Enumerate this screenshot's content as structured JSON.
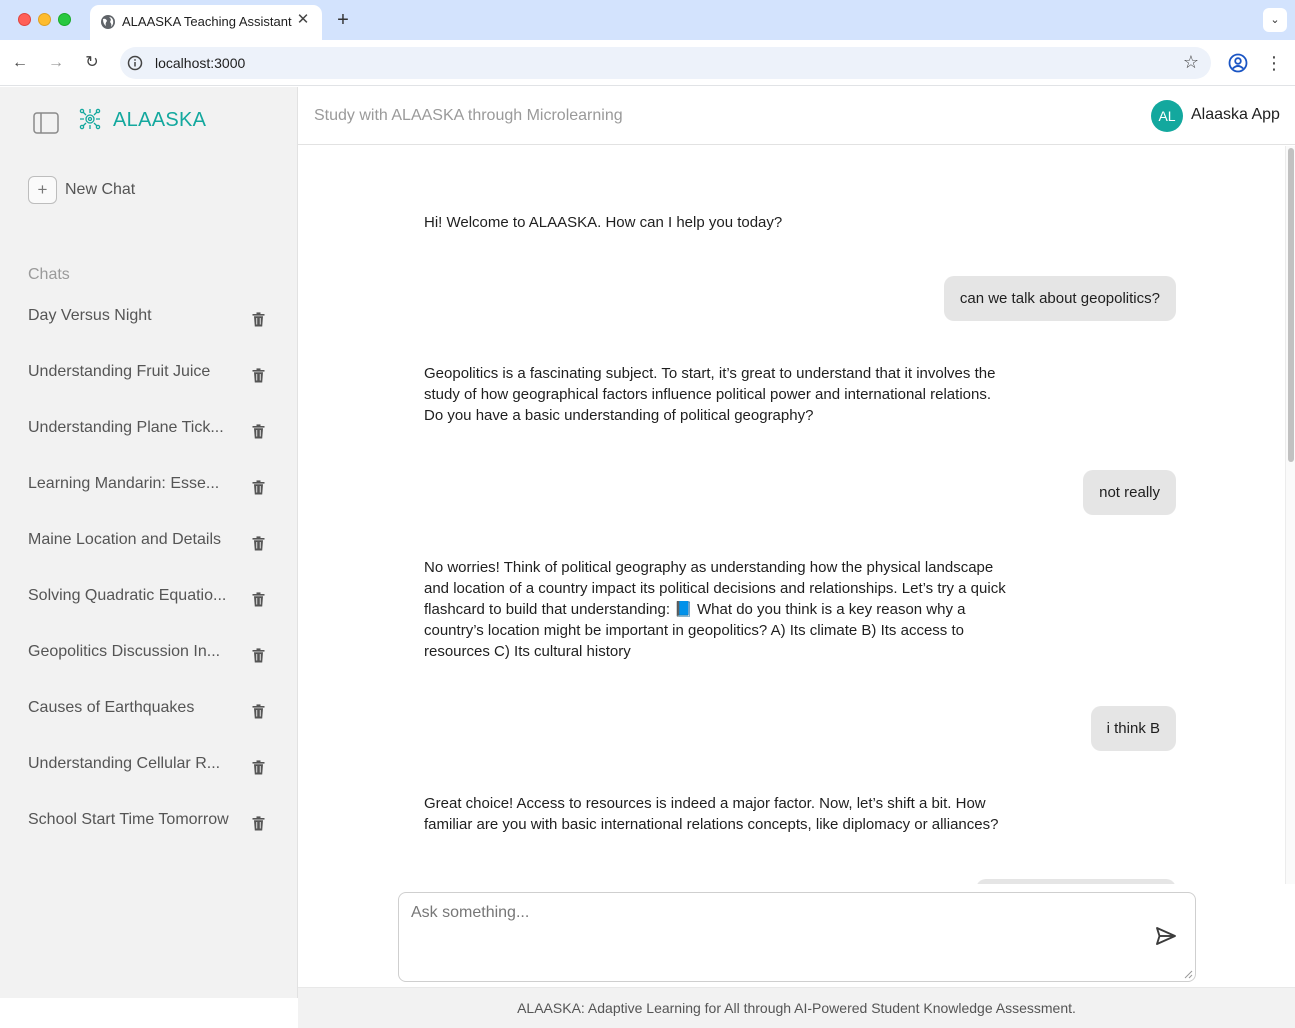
{
  "browser": {
    "tab_title": "ALAASKA Teaching Assistant",
    "url": "localhost:3000",
    "tab_close_glyph": "✕",
    "new_tab_glyph": "+",
    "tab_menu_glyph": "⌄",
    "back_glyph": "←",
    "forward_glyph": "→",
    "reload_glyph": "↻",
    "star_glyph": "☆",
    "menu_glyph": "⋮"
  },
  "sidebar": {
    "brand": "ALAASKA",
    "brand_color": "#13a89e",
    "new_chat_icon": "+",
    "new_chat_label": "New Chat",
    "chats_heading": "Chats",
    "chats": [
      {
        "title": "Day Versus Night"
      },
      {
        "title": "Understanding Fruit Juice"
      },
      {
        "title": "Understanding Plane Tick..."
      },
      {
        "title": "Learning Mandarin: Esse..."
      },
      {
        "title": "Maine Location and Details"
      },
      {
        "title": "Solving Quadratic Equatio..."
      },
      {
        "title": "Geopolitics Discussion In..."
      },
      {
        "title": "Causes of Earthquakes"
      },
      {
        "title": "Understanding Cellular R..."
      },
      {
        "title": "School Start Time Tomorrow"
      }
    ]
  },
  "header": {
    "subtitle": "Study with ALAASKA through Microlearning",
    "avatar_initials": "AL",
    "user_name": "Alaaska App"
  },
  "messages": [
    {
      "role": "assistant",
      "text": "Hi! Welcome to ALAASKA. How can I help you today?"
    },
    {
      "role": "user",
      "text": "can we talk about geopolitics?"
    },
    {
      "role": "assistant",
      "text": "Geopolitics is a fascinating subject. To start, it’s great to understand that it involves the study of how geographical factors influence political power and international relations. Do you have a basic understanding of political geography?"
    },
    {
      "role": "user",
      "text": "not really"
    },
    {
      "role": "assistant",
      "text": "No worries! Think of political geography as understanding how the physical landscape and location of a country impact its political decisions and relationships. Let’s try a quick flashcard to build that understanding: 📘 What do you think is a key reason why a country’s location might be important in geopolitics? A) Its climate B) Its access to resources C) Its cultural history"
    },
    {
      "role": "user",
      "text": "i think B"
    },
    {
      "role": "assistant",
      "text": "Great choice! Access to resources is indeed a major factor. Now, let’s shift a bit. How familiar are you with basic international relations concepts, like diplomacy or alliances?"
    }
  ],
  "composer": {
    "placeholder": "Ask something..."
  },
  "footer": {
    "text": "ALAASKA: Adaptive Learning for All through AI-Powered Student Knowledge Assessment."
  }
}
